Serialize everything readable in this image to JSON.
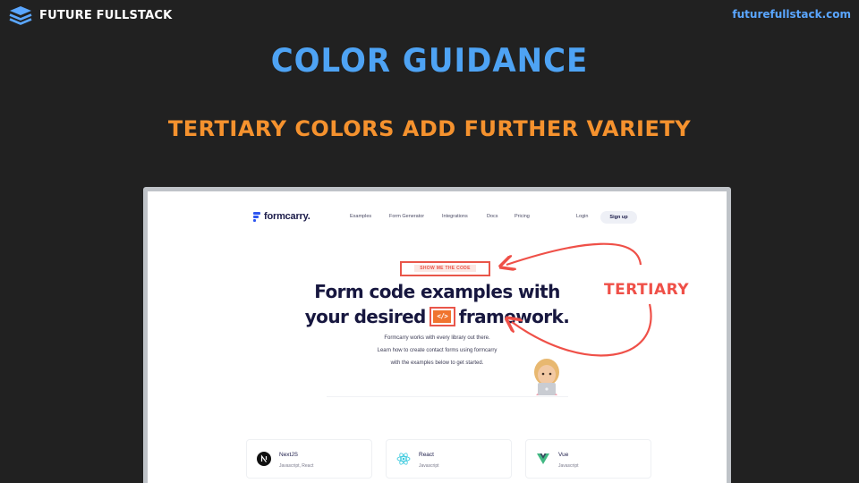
{
  "header": {
    "brand": "FUTURE FULLSTACK",
    "site": "futurefullstack.com"
  },
  "slide": {
    "title": "COLOR GUIDANCE",
    "subtitle": "TERTIARY COLORS ADD FURTHER VARIETY",
    "annotation": "TERTIARY"
  },
  "colors": {
    "title": "#4ea3f4",
    "subtitle": "#f5922e",
    "annotation": "#ef5048",
    "background": "#212121"
  },
  "screenshot": {
    "logo": "formcarry.",
    "nav": [
      "Examples",
      "Form Generator",
      "Integrations",
      "Docs",
      "Pricing"
    ],
    "login": "Login",
    "signup": "Sign up",
    "badge": "SHOW ME THE CODE",
    "hero_line1": "Form code examples with",
    "hero_line2_a": "your desired",
    "code_glyph": "</>",
    "hero_line2_b": "framework.",
    "desc": [
      "Formcarry works with every library out there.",
      "Learn how to create contact forms using formcarry",
      "with the examples below to get started."
    ],
    "cards": [
      {
        "name": "NextJS",
        "sub": "Javascript, React",
        "icon": "nextjs-icon"
      },
      {
        "name": "React",
        "sub": "Javascript",
        "icon": "react-icon"
      },
      {
        "name": "Vue",
        "sub": "Javascript",
        "icon": "vue-icon"
      }
    ]
  }
}
